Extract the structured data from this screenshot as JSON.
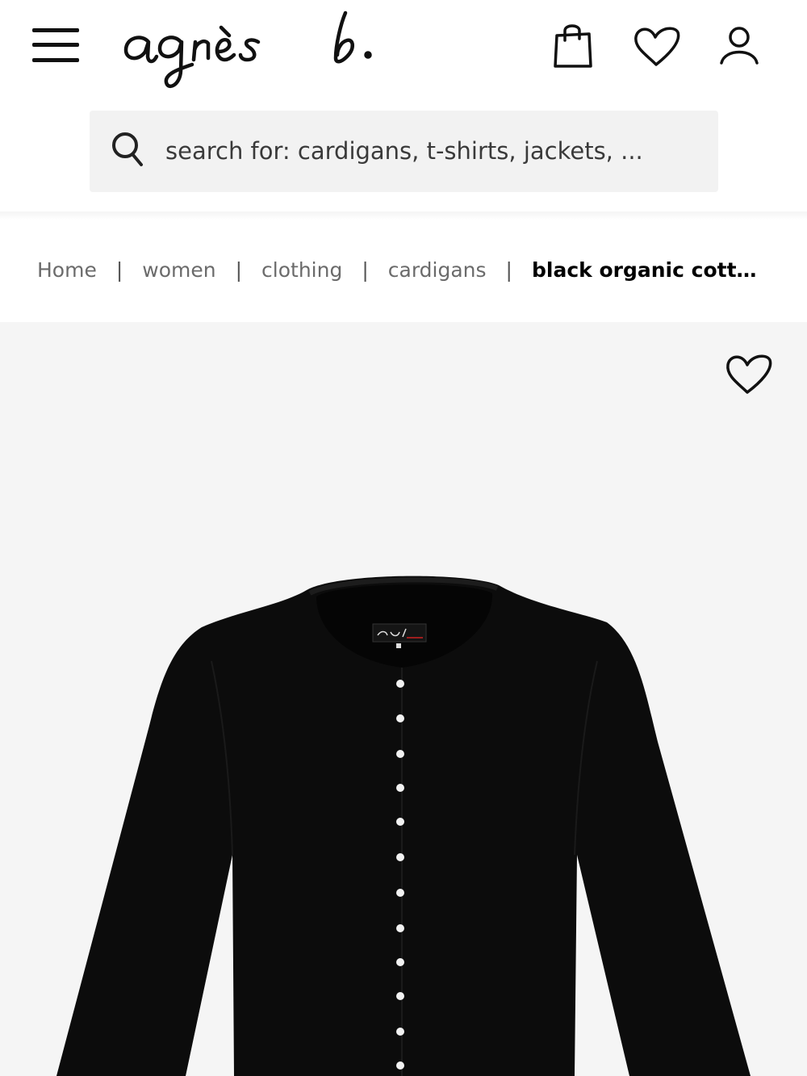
{
  "header": {
    "brand": "agnès b.",
    "menu_icon": "hamburger-menu-icon",
    "bag_icon": "shopping-bag-icon",
    "wishlist_icon": "heart-icon",
    "account_icon": "user-icon"
  },
  "search": {
    "placeholder": "search for: cardigans, t-shirts, jackets, ...",
    "value": ""
  },
  "breadcrumb": {
    "items": [
      "Home",
      "women",
      "clothing",
      "cardigans"
    ],
    "current": "black organic cotto..."
  },
  "product": {
    "favorite_icon": "heart-outline-icon",
    "image_alt": "black cardigan with white snap buttons",
    "colors": {
      "background": "#f5f5f5",
      "garment": "#0c0c0c",
      "snaps": "#f2f2f2"
    }
  }
}
